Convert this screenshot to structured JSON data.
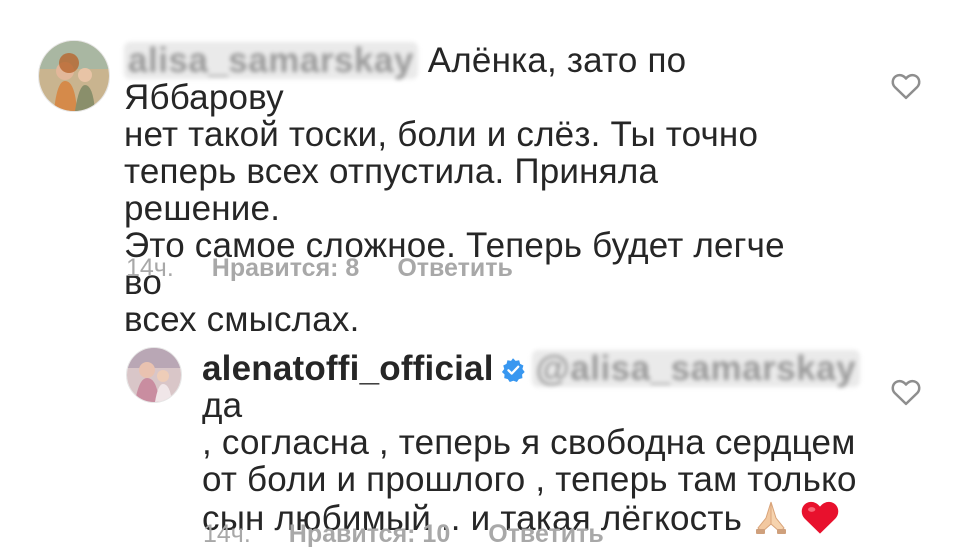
{
  "comment1": {
    "username_hidden": "alisa_samarskay",
    "text_lines": [
      "Алёнка, зато по Яббарову",
      "нет такой тоски, боли и слёз. Ты точно",
      "теперь всех отпустила. Приняла решение.",
      "Это самое сложное. Теперь будет легче во",
      "всех смыслах."
    ],
    "time": "14ч.",
    "likes_label": "Нравится: 8",
    "reply_label": "Ответить"
  },
  "comment2": {
    "username": "alenatoffi_official",
    "mention_hidden": "@alisa_samarskay",
    "text_first": "да",
    "text_lines": [
      ", согласна , теперь я свободна сердцем",
      "от боли и прошлого , теперь там только",
      "сын любимый .. и такая лёгкость"
    ],
    "time": "14ч.",
    "likes_label": "Нравится: 10",
    "reply_label": "Ответить"
  },
  "icons": {
    "heart_outline": "heart-icon",
    "verified": "verified-badge-icon",
    "pray_emoji": "praying-hands-emoji",
    "red_heart_emoji": "red-heart-emoji"
  },
  "colors": {
    "text": "#262626",
    "meta": "#a8a8a8",
    "verified": "#3897f0",
    "heart_emoji": "#e8112d"
  }
}
